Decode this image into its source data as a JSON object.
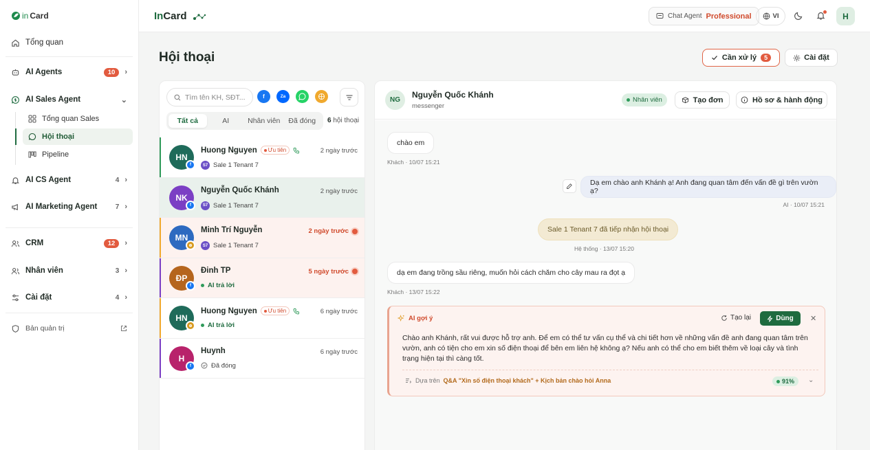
{
  "app": {
    "logo_in": "in",
    "logo_card": "Card"
  },
  "topbar": {
    "brand_in": "In",
    "brand_card": "Card",
    "chat_agent_label": "Chat Agent",
    "plan": "Professional",
    "lang": "VI",
    "avatar": "H"
  },
  "sidebar": {
    "overview": "Tổng quan",
    "ai_agents": {
      "label": "AI Agents",
      "count": "10"
    },
    "ai_sales": {
      "label": "AI Sales Agent"
    },
    "sales_sub": [
      {
        "label": "Tổng quan Sales"
      },
      {
        "label": "Hội thoại"
      },
      {
        "label": "Pipeline"
      }
    ],
    "ai_cs": {
      "label": "AI CS Agent",
      "count": "4"
    },
    "ai_marketing": {
      "label": "AI Marketing Agent",
      "count": "7"
    },
    "crm": {
      "label": "CRM",
      "count": "12"
    },
    "staff": {
      "label": "Nhân viên",
      "count": "3"
    },
    "settings": {
      "label": "Cài đặt",
      "count": "4"
    },
    "admin": {
      "label": "Bản quản trị"
    }
  },
  "page": {
    "title": "Hội thoại",
    "need_handle": "Cần xử lý",
    "need_handle_count": "5",
    "settings": "Cài đặt"
  },
  "list": {
    "search_placeholder": "Tìm tên KH, SĐT...",
    "tabs": [
      "Tất cả",
      "AI",
      "Nhân viên",
      "Đã đóng"
    ],
    "count_num": "6",
    "count_label": "hội thoại",
    "rows": [
      {
        "initials": "HN",
        "name": "Huong Nguyen",
        "priority": "Ưu tiên",
        "time": "2 ngày trước",
        "assignee": "Sale 1 Tenant 7",
        "badge": "S7"
      },
      {
        "initials": "NK",
        "name": "Nguyễn Quốc Khánh",
        "time": "2 ngày trước",
        "assignee": "Sale 1 Tenant 7",
        "badge": "S7"
      },
      {
        "initials": "MN",
        "name": "Minh Trí Nguyễn",
        "time": "2 ngày trước",
        "assignee": "Sale 1 Tenant 7",
        "badge": "S7"
      },
      {
        "initials": "ĐP",
        "name": "Đinh TP",
        "time": "5 ngày trước",
        "status": "AI trả lời"
      },
      {
        "initials": "HN",
        "name": "Huong Nguyen",
        "priority": "Ưu tiên",
        "time": "6 ngày trước",
        "status": "AI trả lời"
      },
      {
        "initials": "H",
        "name": "Huynh",
        "time": "6 ngày trước",
        "status": "Đã đóng"
      }
    ],
    "colors": {
      "primary": "#1e6b3f",
      "alert": "#e25b3f"
    }
  },
  "chat": {
    "initials": "NG",
    "name": "Nguyễn Quốc Khánh",
    "source": "messenger",
    "staff_badge": "Nhân viên",
    "create_order": "Tạo đơn",
    "profile_actions": "Hồ sơ & hành động",
    "messages": [
      {
        "text": "chào em",
        "stamp": "Khách · 10/07 15:21"
      },
      {
        "text": "Dạ em chào anh Khánh ạ! Anh đang quan tâm đến vấn đề gì trên vườn ạ?",
        "stamp": "AI · 10/07 15:21"
      },
      {
        "text": "Sale 1 Tenant 7 đã tiếp nhận hội thoại",
        "stamp": "Hệ thống · 13/07 15:20"
      },
      {
        "text": "dạ em đang trồng sầu riêng, muốn hỏi cách chăm cho cây mau ra đọt ạ",
        "stamp": "Khách · 13/07 15:22"
      }
    ],
    "suggestion": {
      "title": "AI gợi ý",
      "regen": "Tạo lại",
      "use": "Dùng",
      "text": "Chào anh Khánh, rất vui được hỗ trợ anh. Để em có thể tư vấn cụ thể và chi tiết hơn về những vấn đề anh đang quan tâm trên vườn, anh có tiện cho em xin số điện thoại để bên em liên hệ không ạ? Nếu anh có thể cho em biết thêm về loại cây và tình trạng hiện tại thì càng tốt.",
      "based_on": "Dựa trên",
      "source": "Q&A \"Xin số điện thoại khách\" + Kịch bản chào hỏi Anna",
      "confidence": "91%"
    }
  }
}
